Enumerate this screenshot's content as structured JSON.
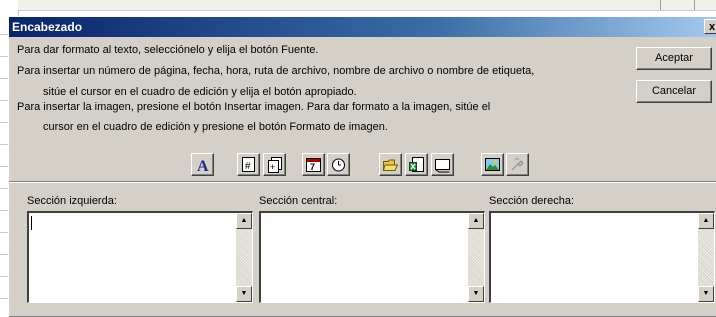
{
  "dialog": {
    "title": "Encabezado",
    "close_label": "x",
    "instructions": [
      "Para dar formato al texto, selecciónelo y elija el botón Fuente.",
      "Para insertar un número de página, fecha, hora, ruta de archivo, nombre de archivo o nombre de etiqueta,",
      "sitúe el cursor en el cuadro de edición y elija el botón apropiado.",
      "Para insertar la imagen, presione el botón Insertar imagen. Para dar formato a la imagen, sitúe el",
      "cursor en el cuadro de edición y presione el botón Formato de imagen."
    ],
    "buttons": {
      "ok": "Aceptar",
      "cancel": "Cancelar"
    },
    "toolbar": {
      "font_glyph": "A",
      "page_glyph": "#",
      "pages_glyph": "+",
      "date_glyph": "7"
    },
    "sections": {
      "left": {
        "label": "Sección izquierda:",
        "value": ""
      },
      "center": {
        "label": "Sección central:",
        "value": ""
      },
      "right": {
        "label": "Sección derecha:",
        "value": ""
      }
    },
    "scroll_arrows": {
      "up": "▲",
      "down": "▼"
    },
    "colors": {
      "title_bar": "#0a246a",
      "face": "#d4d0c8",
      "font_icon": "#1c2e8c"
    },
    "icons": [
      "font-icon",
      "page-number-icon",
      "total-pages-icon",
      "date-icon",
      "time-icon",
      "file-path-icon",
      "filename-icon",
      "sheet-name-icon",
      "insert-picture-icon",
      "format-picture-icon"
    ]
  }
}
